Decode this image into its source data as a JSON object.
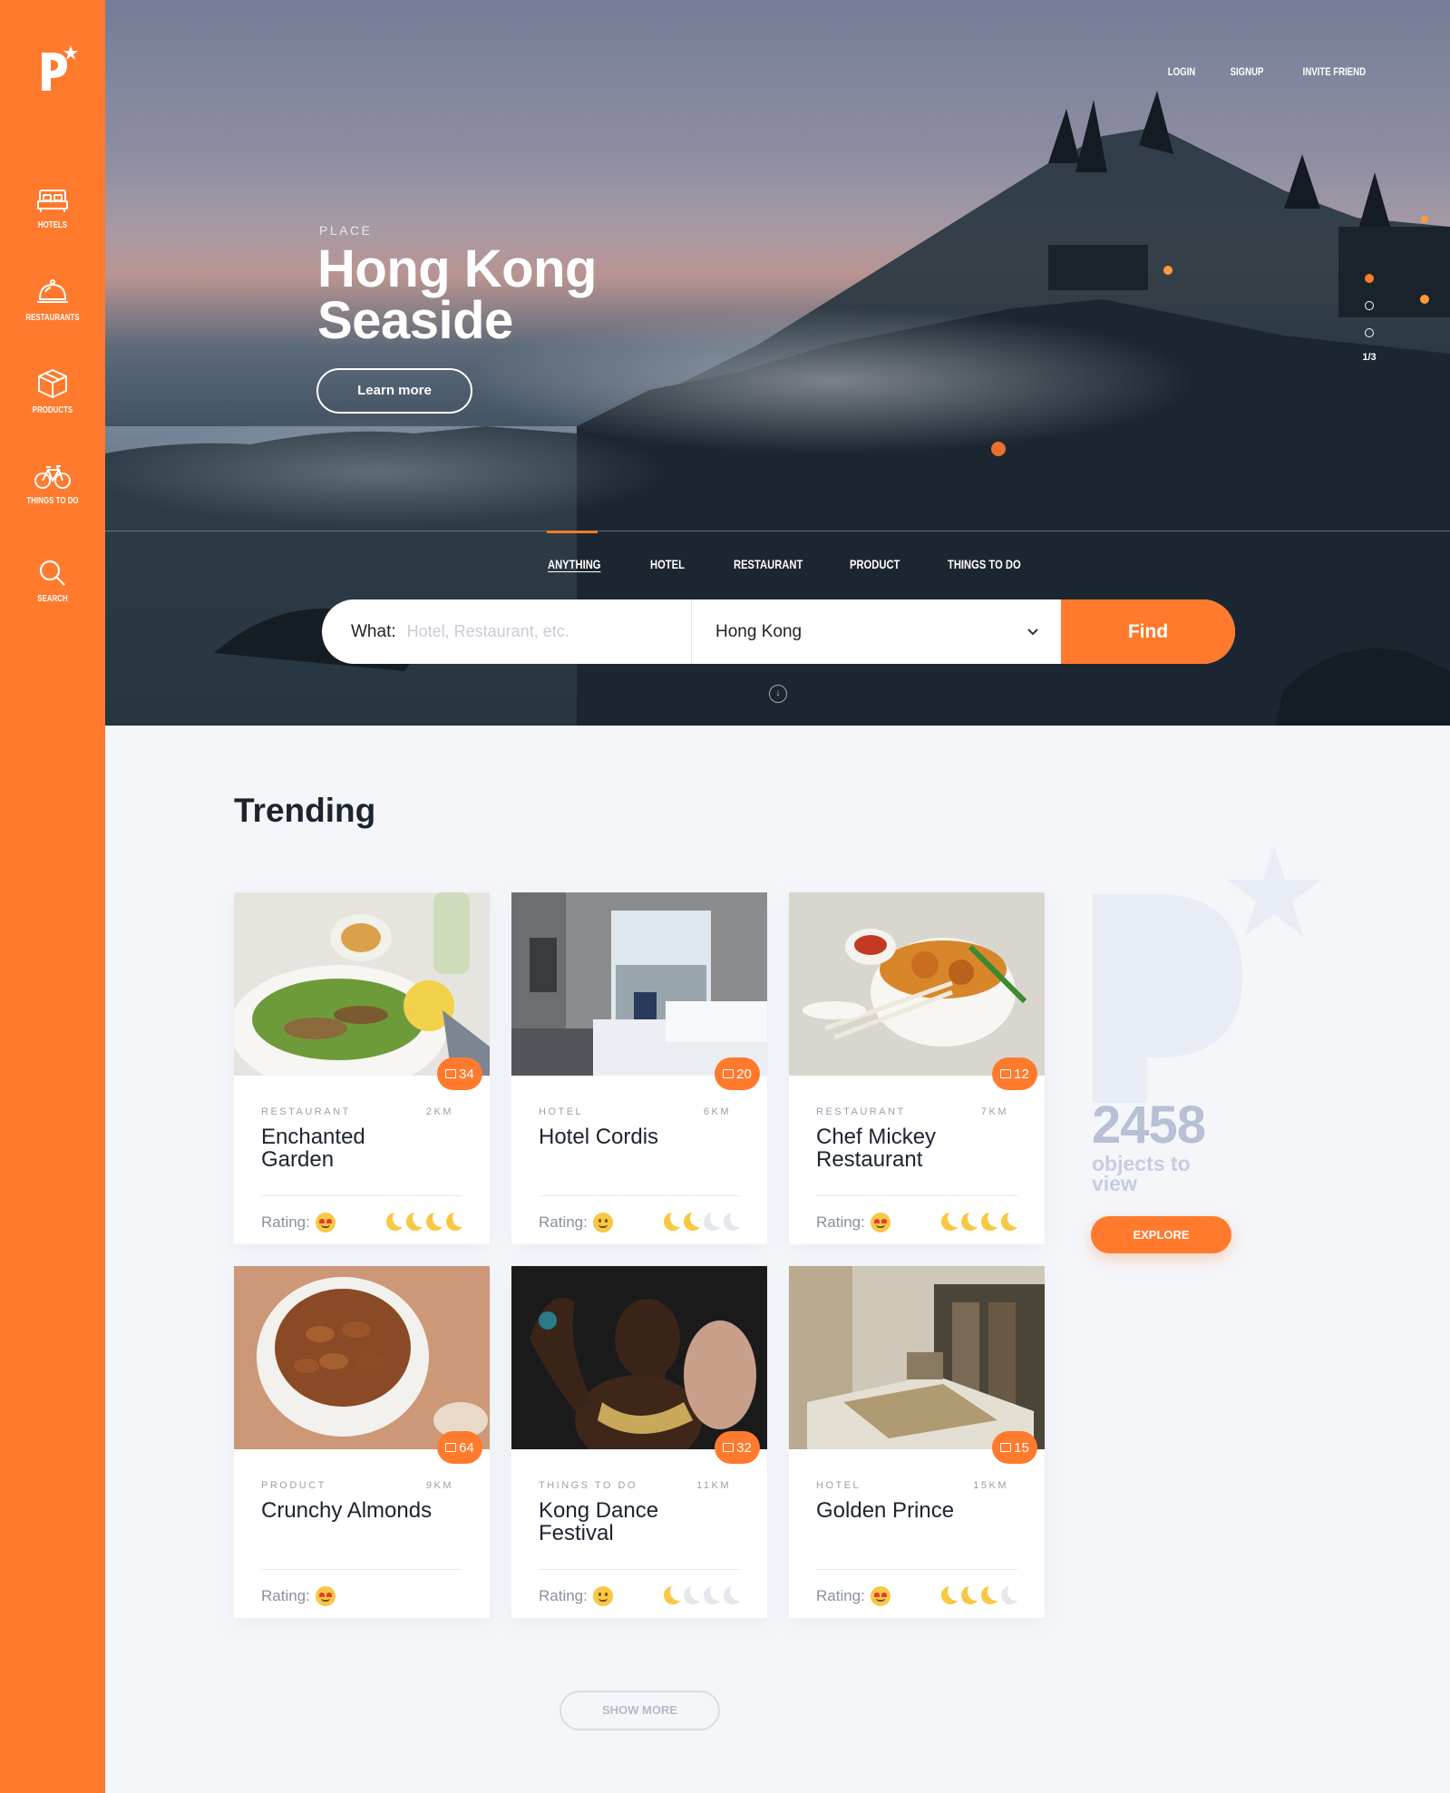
{
  "brand": {
    "accent": "#ff7a2d",
    "logo_text": "P"
  },
  "sidebar": {
    "items": [
      {
        "label": "HOTELS",
        "icon": "bed-icon"
      },
      {
        "label": "RESTAURANTS",
        "icon": "cloche-icon"
      },
      {
        "label": "PRODUCTS",
        "icon": "box-icon"
      },
      {
        "label": "THINGS TO DO",
        "icon": "bicycle-icon"
      },
      {
        "label": "SEARCH",
        "icon": "search-icon"
      }
    ]
  },
  "topnav": {
    "login": "LOGIN",
    "signup": "SIGNUP",
    "invite": "INVITE FRIEND"
  },
  "hero": {
    "tag": "PLACE",
    "title": "Hong Kong Seaside",
    "cta": "Learn more",
    "pager": "1/3",
    "slide_index": 1,
    "slide_total": 3
  },
  "tabs": [
    "ANYTHING",
    "HOTEL",
    "RESTAURANT",
    "PRODUCT",
    "THINGS TO DO"
  ],
  "active_tab": "ANYTHING",
  "search": {
    "what_label": "What:",
    "what_placeholder": "Hotel, Restaurant, etc.",
    "location": "Hong Kong",
    "find": "Find"
  },
  "trending": {
    "title": "Trending",
    "cards": [
      {
        "category": "RESTAURANT",
        "distance": "2KM",
        "name": "Enchanted Garden",
        "comments": "34",
        "rating_label": "Rating:",
        "emoji": "heart-eyes",
        "stars": 3.5
      },
      {
        "category": "HOTEL",
        "distance": "6KM",
        "name": "Hotel Cordis",
        "comments": "20",
        "rating_label": "Rating:",
        "emoji": "smile",
        "stars": 2
      },
      {
        "category": "RESTAURANT",
        "distance": "7KM",
        "name": "Chef Mickey Restaurant",
        "comments": "12",
        "rating_label": "Rating:",
        "emoji": "heart-eyes",
        "stars": 4
      },
      {
        "category": "PRODUCT",
        "distance": "9KM",
        "name": "Crunchy Almonds",
        "comments": "64",
        "rating_label": "Rating:",
        "emoji": "heart-eyes",
        "stars": 0
      },
      {
        "category": "THINGS TO DO",
        "distance": "11KM",
        "name": "Kong Dance Festival",
        "comments": "32",
        "rating_label": "Rating:",
        "emoji": "smile",
        "stars": 1
      },
      {
        "category": "HOTEL",
        "distance": "15KM",
        "name": "Golden Prince",
        "comments": "15",
        "rating_label": "Rating:",
        "emoji": "heart-eyes",
        "stars": 3
      }
    ]
  },
  "stats": {
    "count": "2458",
    "label": "objects to view",
    "explore": "EXPLORE"
  },
  "show_more": "SHOW MORE"
}
